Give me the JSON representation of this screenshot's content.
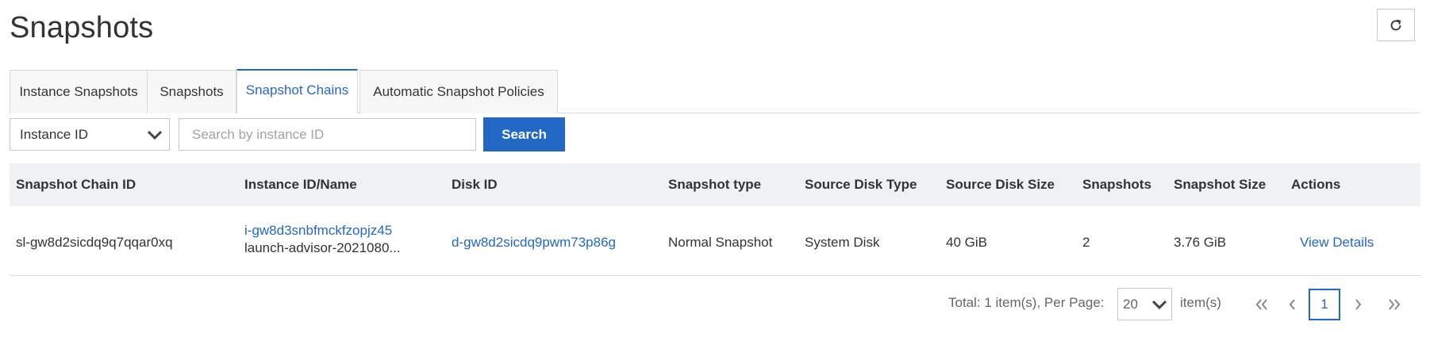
{
  "page": {
    "title": "Snapshots"
  },
  "header": {
    "refresh_icon": "refresh-icon"
  },
  "tabs": [
    {
      "label": "Instance Snapshots",
      "active": false
    },
    {
      "label": "Snapshots",
      "active": false
    },
    {
      "label": "Snapshot Chains",
      "active": true
    },
    {
      "label": "Automatic Snapshot Policies",
      "active": false
    }
  ],
  "filter": {
    "select_value": "Instance ID",
    "search_placeholder": "Search by instance ID",
    "search_value": "",
    "search_button": "Search"
  },
  "table": {
    "columns": [
      "Snapshot Chain ID",
      "Instance ID/Name",
      "Disk ID",
      "Snapshot type",
      "Source Disk Type",
      "Source Disk Size",
      "Snapshots",
      "Snapshot Size",
      "Actions"
    ],
    "rows": [
      {
        "snapshot_chain_id": "sl-gw8d2sicdq9q7qqar0xq",
        "instance_id": "i-gw8d3snbfmckfzopjz45",
        "instance_name": "launch-advisor-2021080...",
        "disk_id": "d-gw8d2sicdq9pwm73p86g",
        "snapshot_type": "Normal Snapshot",
        "source_disk_type": "System Disk",
        "source_disk_size": "40 GiB",
        "snapshots": "2",
        "snapshot_size": "3.76 GiB",
        "action": "View Details"
      }
    ]
  },
  "pagination": {
    "total_text": "Total: 1 item(s), Per Page:",
    "per_page": "20",
    "items_suffix": "item(s)",
    "current_page": "1"
  },
  "colors": {
    "accent": "#2468c6",
    "header_bg": "#eff2f5"
  }
}
